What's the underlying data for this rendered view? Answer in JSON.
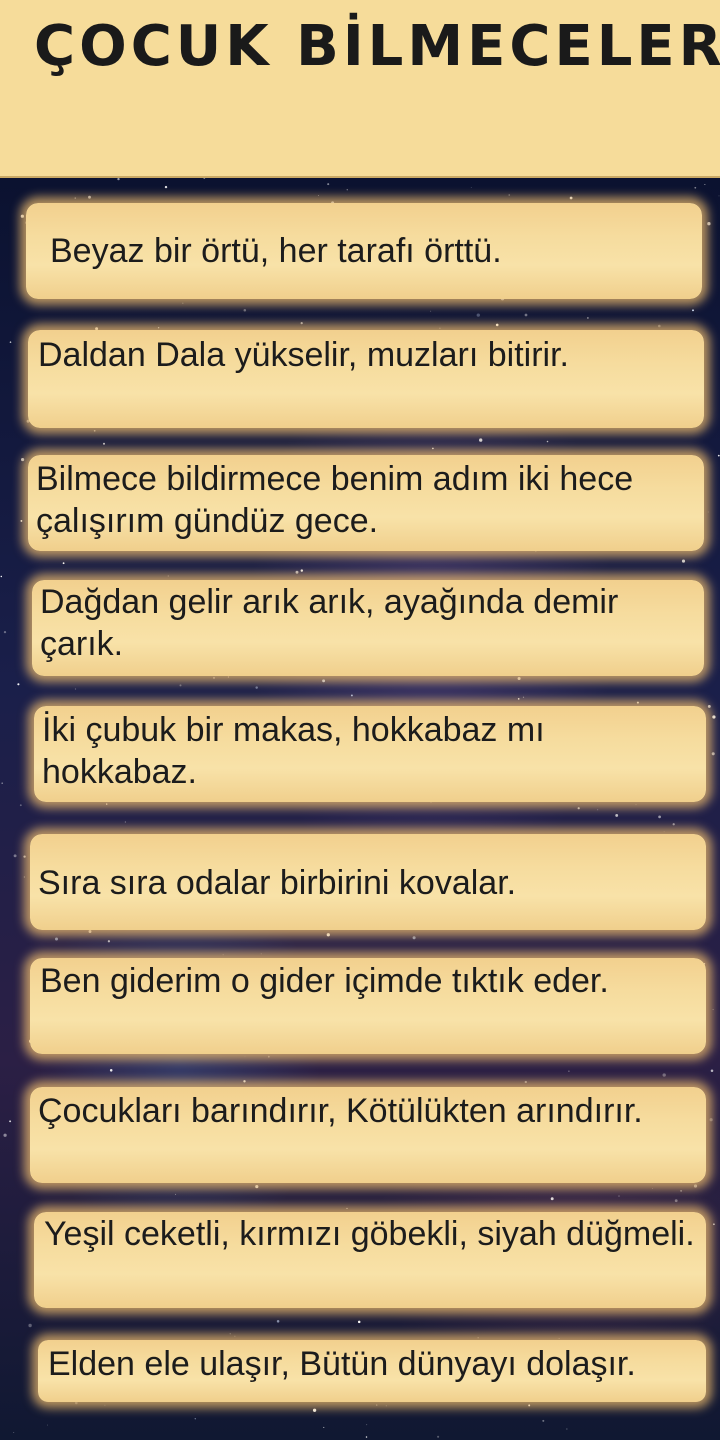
{
  "app": {
    "title": "ÇOCUK BİLMECELERİ"
  },
  "riddles": [
    "Beyaz bir örtü, her tarafı örttü.",
    "Daldan Dala yükselir, muzları bitirir.",
    "Bilmece bildirmece benim adım iki hece çalışırım gündüz gece.",
    "Dağdan gelir arık arık, ayağında demir çarık.",
    "İki çubuk bir makas, hokkabaz mı hokkabaz.",
    "Sıra sıra odalar birbirini kovalar.",
    "Ben giderim o gider içimde tıktık eder.",
    "Çocukları barındırır, Kötülükten arındırır.",
    "Yeşil ceketli, kırmızı göbekli, siyah düğmeli.",
    "Elden ele ulaşır, Bütün dünyayı dolaşır."
  ],
  "colors": {
    "header_bg": "#f6dc9a",
    "card_bg": "#f6dc9e",
    "card_glow": "#f0be6e",
    "text": "#1c1c1c",
    "space_bg": "#0b1230"
  }
}
